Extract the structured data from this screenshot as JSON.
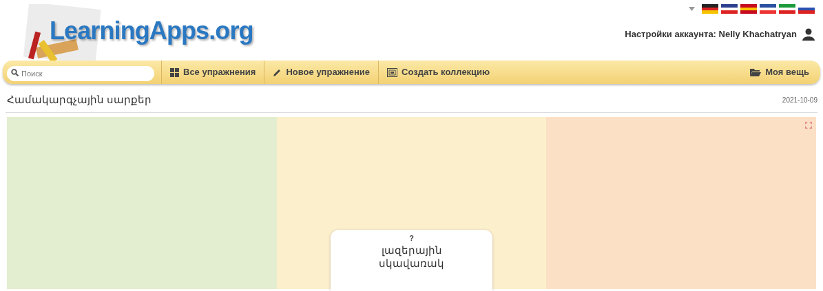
{
  "logo": "LearningApps.org",
  "account": {
    "label": "Настройки аккаунта: Nelly Khachatryan"
  },
  "search": {
    "placeholder": "Поиск"
  },
  "nav": [
    {
      "label": "Все упражнения"
    },
    {
      "label": "Новое упражнение"
    },
    {
      "label": "Создать коллекцию"
    }
  ],
  "nav_right": {
    "label": "Моя вещь"
  },
  "app": {
    "title": "Համակարգչային սարքեր",
    "date": "2021-10-09"
  },
  "columns": [
    {
      "color": "#e3edcf"
    },
    {
      "color": "#fcefcc"
    },
    {
      "color": "#fbe0c6"
    }
  ],
  "card": {
    "hint": "?",
    "text": "լազերային սկավառակ"
  }
}
